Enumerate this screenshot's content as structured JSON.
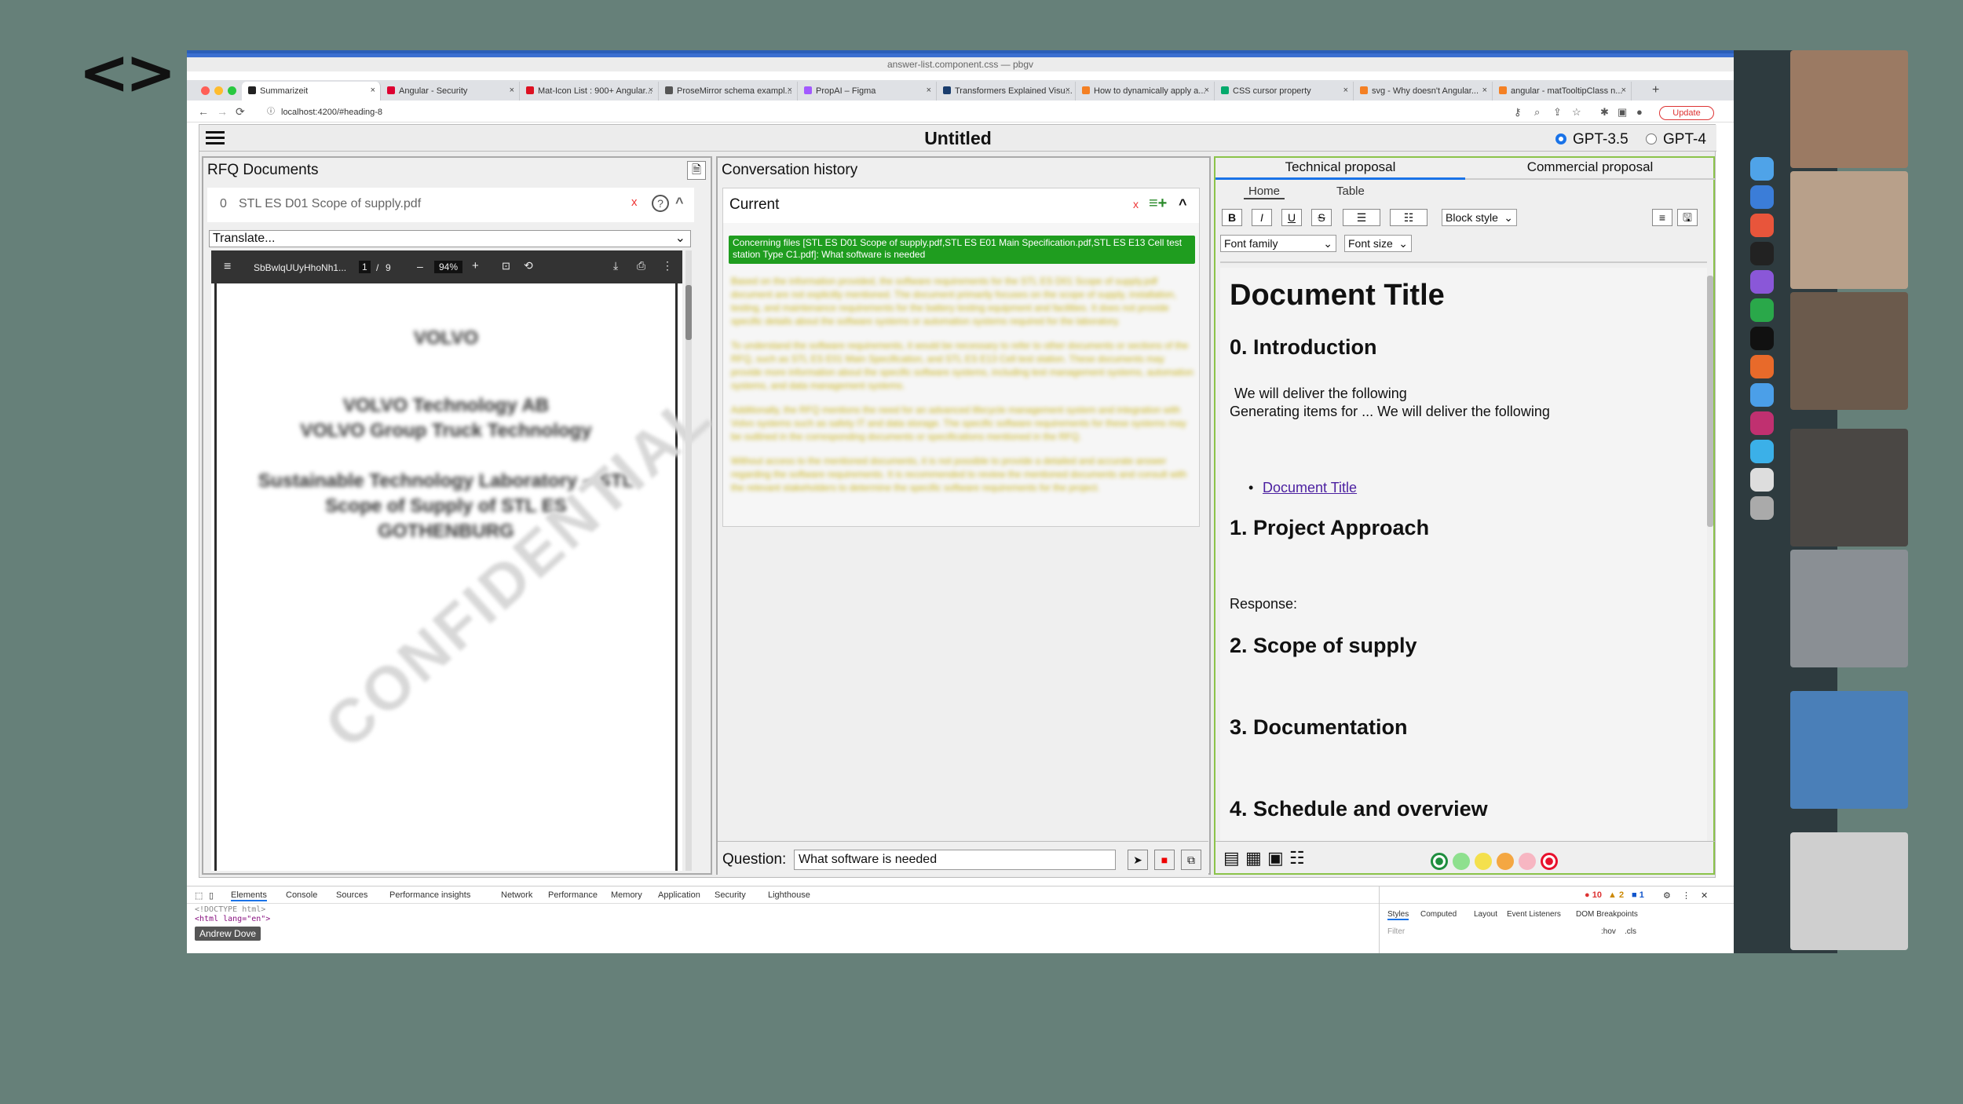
{
  "browser": {
    "window_title": "answer-list.component.css — pbgv",
    "tabs": [
      {
        "label": "Summarizeit",
        "active": true,
        "favicon_color": "#222"
      },
      {
        "label": "Angular - Security",
        "active": false,
        "favicon_color": "#dd0031"
      },
      {
        "label": "Mat-Icon List : 900+ Angular...",
        "active": false,
        "favicon_color": "#d12"
      },
      {
        "label": "ProseMirror schema exampl...",
        "active": false,
        "favicon_color": "#555"
      },
      {
        "label": "PropAI – Figma",
        "active": false,
        "favicon_color": "#a259ff"
      },
      {
        "label": "Transformers Explained Visu...",
        "active": false,
        "favicon_color": "#1a3d6d"
      },
      {
        "label": "How to dynamically apply a...",
        "active": false,
        "favicon_color": "#f48024"
      },
      {
        "label": "CSS cursor property",
        "active": false,
        "favicon_color": "#04aa6d"
      },
      {
        "label": "svg - Why doesn't Angular...",
        "active": false,
        "favicon_color": "#f48024"
      },
      {
        "label": "angular - matTooltipClass n...",
        "active": false,
        "favicon_color": "#f48024"
      }
    ],
    "new_tab_icon": "plus-icon",
    "url": "localhost:4200/#heading-8",
    "update_label": "Update"
  },
  "app": {
    "title": "Untitled",
    "models": [
      {
        "label": "GPT-3.5",
        "selected": true
      },
      {
        "label": "GPT-4",
        "selected": false
      }
    ],
    "rfq": {
      "title": "RFQ Documents",
      "doc_index": "0",
      "doc_name": "STL ES D01 Scope of supply.pdf",
      "remove_label": "x",
      "translate_placeholder": "Translate...",
      "pdf": {
        "filename": "SbBwlqUUyHhoNh1...",
        "page_current": "1",
        "page_sep": "/",
        "page_total": "9",
        "zoom": "94%",
        "blurred_lines": [
          "VOLVO",
          "VOLVO Technology AB",
          "VOLVO Group Truck Technology",
          "Sustainable Technology Laboratory – STL",
          "Scope of Supply of STL ES",
          "GOTHENBURG"
        ],
        "watermark": "CONFIDENTIAL"
      }
    },
    "conversation": {
      "title": "Conversation history",
      "current_label": "Current",
      "remove_label": "x",
      "message": "Concerning files [STL ES D01 Scope of supply.pdf,STL ES E01 Main Specification.pdf,STL ES E13 Cell test station Type C1.pdf]: What software is needed",
      "answer_paragraphs": [
        "Based on the information provided, the software requirements for the STL ES D01 Scope of supply.pdf document are not explicitly mentioned. The document primarily focuses on the scope of supply, installation, testing, and maintenance requirements for the battery testing equipment and facilities. It does not provide specific details about the software systems or automation systems required for the laboratory.",
        "To understand the software requirements, it would be necessary to refer to other documents or sections of the RFQ, such as STL ES E01 Main Specification, and STL ES E13 Cell test station. These documents may provide more information about the specific software systems, including test management systems, automation systems, and data management systems.",
        "Additionally, the RFQ mentions the need for an advanced lifecycle management system and integration with Volvo systems such as safety IT and data storage. The specific software requirements for these systems may be outlined in the corresponding documents or specifications mentioned in the RFQ.",
        "Without access to the mentioned documents, it is not possible to provide a detailed and accurate answer regarding the software requirements. It is recommended to review the mentioned documents and consult with the relevant stakeholders to determine the specific software requirements for the project."
      ],
      "question_label": "Question:",
      "question_value": "What software is needed"
    },
    "proposal": {
      "tabs": [
        "Technical proposal",
        "Commercial proposal"
      ],
      "subtabs": [
        "Home",
        "Table"
      ],
      "format": {
        "bold": "B",
        "italic": "I",
        "underline": "U",
        "strike": "S",
        "block_style": "Block style",
        "font_family": "Font family",
        "font_size": "Font size"
      },
      "doc": {
        "title": "Document Title",
        "h_intro": "0. Introduction",
        "intro_line1": "We will deliver the following",
        "intro_line2": "Generating items for ... We will deliver the following",
        "link": "Document Title",
        "h_approach": "1. Project Approach",
        "response": "Response:",
        "h_scope": "2. Scope of supply",
        "h_doc": "3. Documentation",
        "h_schedule": "4. Schedule and overview"
      },
      "status_colors": [
        "#1e8e3e",
        "#8ee08e",
        "#f4e04d",
        "#f4a742",
        "#f7b6c2",
        "#e8112d"
      ]
    }
  },
  "devtools": {
    "tabs": [
      "Elements",
      "Console",
      "Sources",
      "Performance insights",
      "Network",
      "Performance",
      "Memory",
      "Application",
      "Security",
      "Lighthouse"
    ],
    "errors": "10",
    "warnings": "2",
    "info": "1",
    "code_line1": "<!DOCTYPE html>",
    "code_line2": "<html lang=\"en\">",
    "right_tabs": [
      "Styles",
      "Computed",
      "Layout",
      "Event Listeners",
      "DOM Breakpoints"
    ],
    "filter_placeholder": "Filter",
    "hov": ":hov",
    "cls": ".cls"
  },
  "meeting": {
    "participant_name": "Andrew Dove"
  }
}
